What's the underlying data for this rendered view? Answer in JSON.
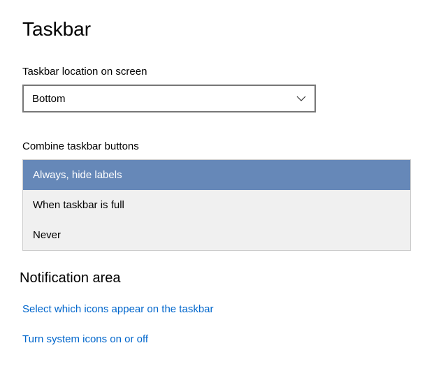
{
  "page": {
    "title": "Taskbar"
  },
  "settings": {
    "location": {
      "label": "Taskbar location on screen",
      "value": "Bottom"
    },
    "combine": {
      "label": "Combine taskbar buttons",
      "options": [
        {
          "label": "Always, hide labels",
          "selected": true
        },
        {
          "label": "When taskbar is full",
          "selected": false
        },
        {
          "label": "Never",
          "selected": false
        }
      ]
    }
  },
  "notification": {
    "heading": "Notification area",
    "links": {
      "select_icons": "Select which icons appear on the taskbar",
      "system_icons": "Turn system icons on or off"
    }
  }
}
